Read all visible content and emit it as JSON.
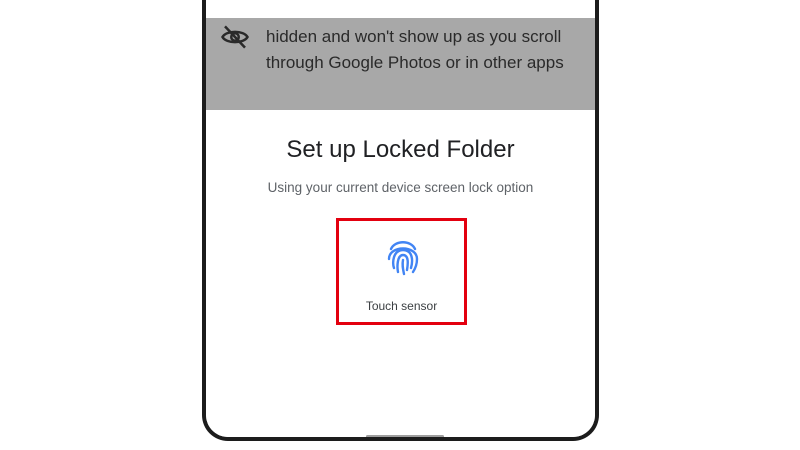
{
  "background_message": {
    "icon": "eye-off-icon",
    "text": "hidden and won't show up as you scroll\nthrough Google Photos or in other apps"
  },
  "dialog": {
    "title": "Set up Locked Folder",
    "subtitle": "Using your current device screen lock option",
    "option": {
      "icon": "fingerprint-icon",
      "label": "Touch sensor",
      "highlighted": true,
      "highlight_color": "#e3000f"
    }
  },
  "colors": {
    "scrim": "#a8a8a8",
    "fingerprint": "#4285f4"
  }
}
